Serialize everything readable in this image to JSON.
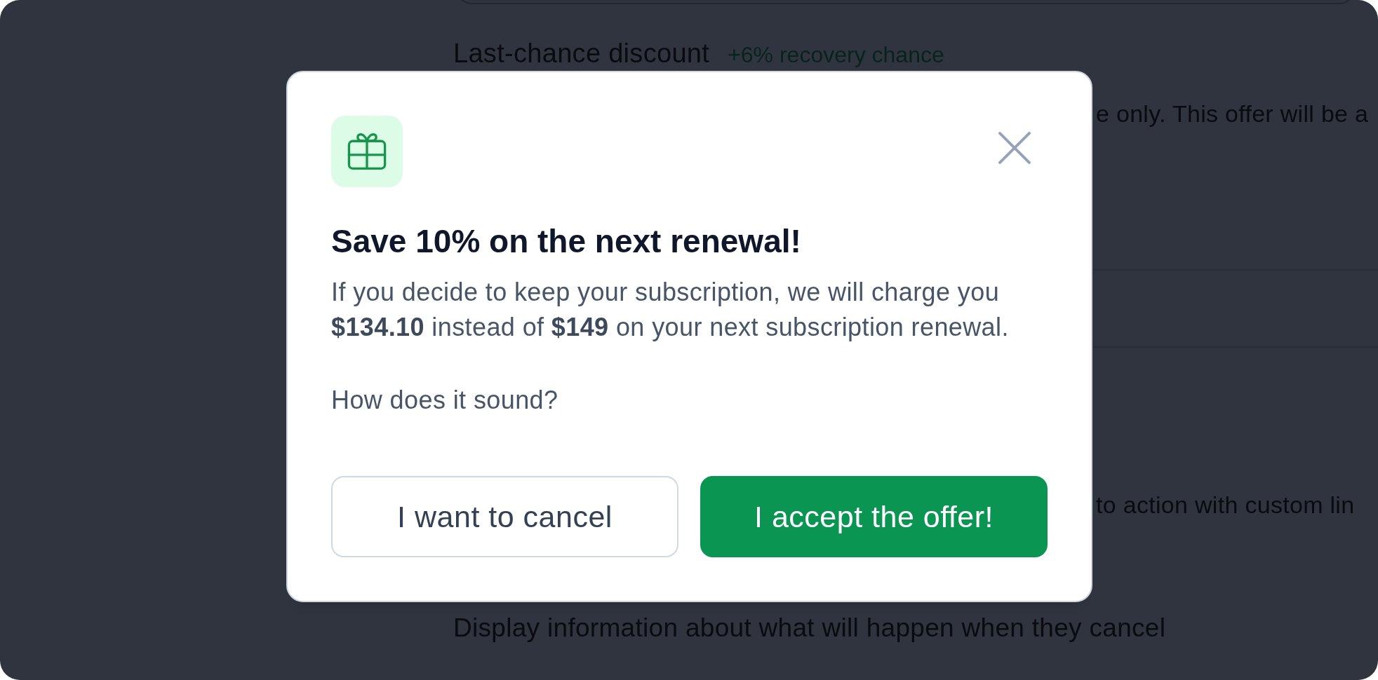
{
  "background": {
    "section_title": "Last-chance discount",
    "section_tag": "+6% recovery chance",
    "description_fragment": "e only. This offer will be a",
    "option_fragment": "to action with custom lin",
    "option_description": "Display information about what will happen when they cancel"
  },
  "dialog": {
    "title": "Save 10% on the next renewal!",
    "paragraphs": [
      "If you decide to keep your subscription, we will charge you **$134.10** instead of **$149** on your next subscription renewal.",
      "How does it sound?"
    ],
    "buttons": [
      {
        "label": "I want to cancel",
        "kind": "secondary"
      },
      {
        "label": "I accept the offer!",
        "kind": "primary"
      }
    ]
  }
}
